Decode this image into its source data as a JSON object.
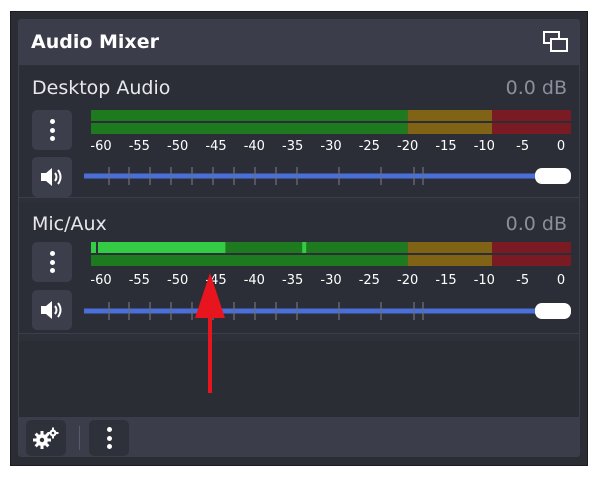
{
  "panel": {
    "title": "Audio Mixer",
    "undock_icon": "undock-icon"
  },
  "scale_labels": [
    "-60",
    "-55",
    "-50",
    "-45",
    "-40",
    "-35",
    "-30",
    "-25",
    "-20",
    "-15",
    "-10",
    "-5",
    "0"
  ],
  "channels": [
    {
      "name": "Desktop Audio",
      "db": "0.0 dB",
      "level_fraction": 0.0,
      "peak_fraction": 0.0,
      "volume_fraction": 1.0,
      "muted": false
    },
    {
      "name": "Mic/Aux",
      "db": "0.0 dB",
      "level_fraction": 0.28,
      "peak_fraction": 0.44,
      "volume_fraction": 1.0,
      "muted": false
    }
  ],
  "colors": {
    "green_inactive": "#1e7a1e",
    "yellow_inactive": "#806314",
    "red_inactive": "#7a1a22",
    "green_active": "#33cc44",
    "slider_track": "#4a6fd8",
    "arrow": "#e8141e"
  },
  "footer": {
    "settings_icon": "gear-icon",
    "menu_icon": "kebab-icon"
  }
}
